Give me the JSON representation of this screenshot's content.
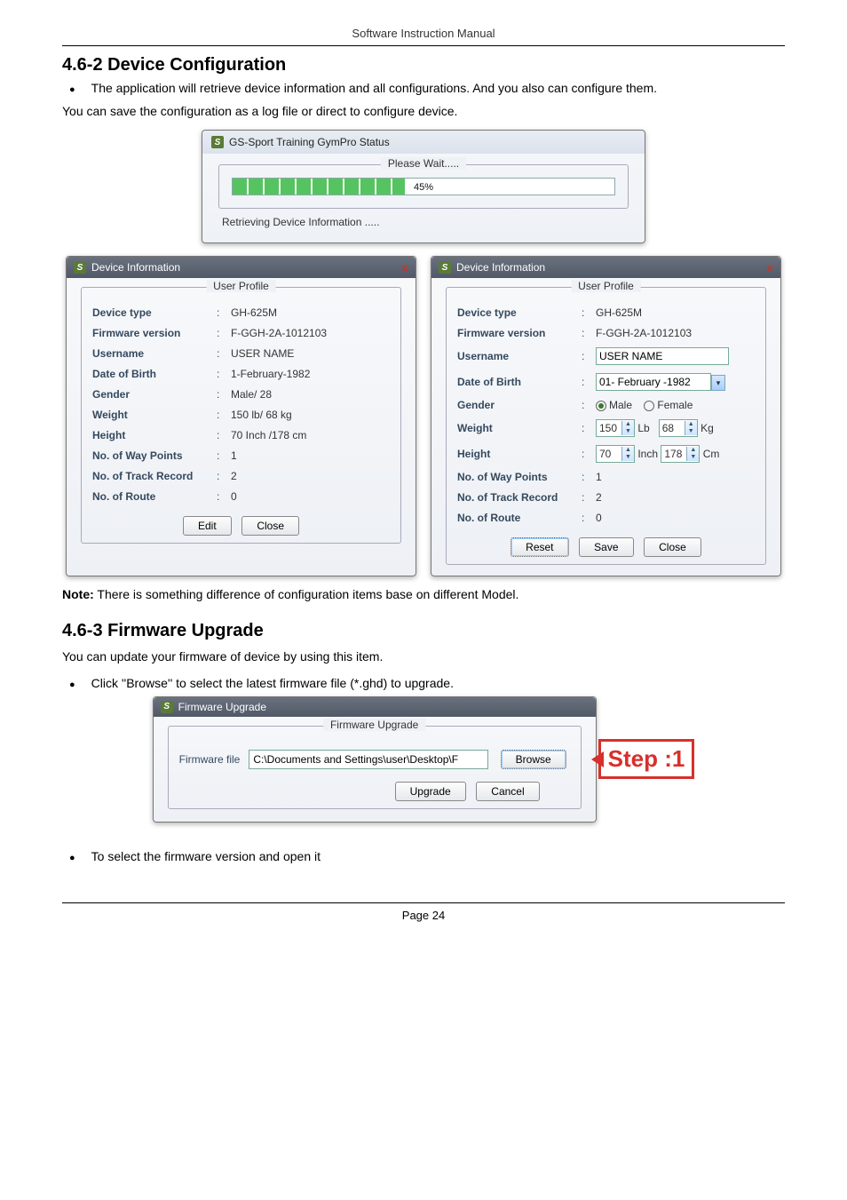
{
  "header": {
    "title": "Software Instruction Manual"
  },
  "section1": {
    "heading": "4.6-2 Device Configuration",
    "bullet": "The application will retrieve device information and all configurations. And you also can configure them.",
    "line2": "You can save the configuration as a log file or direct to configure device."
  },
  "status_dialog": {
    "title": "GS-Sport Training GymPro Status",
    "group_label": "Please Wait.....",
    "progress_text": "45%",
    "footer": "Retrieving Device Information ....."
  },
  "di_left": {
    "title": "Device Information",
    "group": "User Profile",
    "rows": {
      "device_type": {
        "label": "Device type",
        "value": "GH-625M"
      },
      "fw_version": {
        "label": "Firmware version",
        "value": "F-GGH-2A-1012103"
      },
      "username": {
        "label": "Username",
        "value": "USER NAME"
      },
      "dob": {
        "label": "Date of Birth",
        "value": "1-February-1982"
      },
      "gender": {
        "label": "Gender",
        "value": "Male/ 28"
      },
      "weight": {
        "label": "Weight",
        "value": "150 lb/ 68 kg"
      },
      "height": {
        "label": "Height",
        "value": "70 Inch /178 cm"
      },
      "waypoints": {
        "label": "No. of Way Points",
        "value": "1"
      },
      "track": {
        "label": "No. of Track Record",
        "value": "2"
      },
      "route": {
        "label": "No. of Route",
        "value": "0"
      }
    },
    "buttons": {
      "edit": "Edit",
      "close": "Close"
    }
  },
  "di_right": {
    "title": "Device Information",
    "group": "User Profile",
    "rows": {
      "device_type": {
        "label": "Device type",
        "value": "GH-625M"
      },
      "fw_version": {
        "label": "Firmware version",
        "value": "F-GGH-2A-1012103"
      },
      "username": {
        "label": "Username",
        "value_input": "USER NAME"
      },
      "dob": {
        "label": "Date of Birth",
        "value_input": "01- February -1982"
      },
      "gender": {
        "label": "Gender",
        "male": "Male",
        "female": "Female"
      },
      "weight": {
        "label": "Weight",
        "lb": "150",
        "lb_unit": "Lb",
        "kg": "68",
        "kg_unit": "Kg"
      },
      "height": {
        "label": "Height",
        "inch": "70",
        "inch_unit": "Inch",
        "cm": "178",
        "cm_unit": "Cm"
      },
      "waypoints": {
        "label": "No. of Way Points",
        "value": "1"
      },
      "track": {
        "label": "No. of Track Record",
        "value": "2"
      },
      "route": {
        "label": "No. of Route",
        "value": "0"
      }
    },
    "buttons": {
      "reset": "Reset",
      "save": "Save",
      "close": "Close"
    }
  },
  "note": {
    "bold": "Note:",
    "text": " There is something difference of configuration items base on different Model."
  },
  "section2": {
    "heading": "4.6-3 Firmware Upgrade",
    "line": "You can update your firmware of device by using this item.",
    "bullet": "Click ''Browse'' to select the latest firmware file (*.ghd) to upgrade."
  },
  "fw_dialog": {
    "title": "Firmware Upgrade",
    "group": "Firmware Upgrade",
    "file_label": "Firmware file",
    "file_value": "C:\\Documents and Settings\\user\\Desktop\\F",
    "browse": "Browse",
    "upgrade": "Upgrade",
    "cancel": "Cancel"
  },
  "step": {
    "label": "Step :1"
  },
  "bullet3": "To select the firmware version and open it",
  "footer": {
    "text": "Page 24"
  }
}
